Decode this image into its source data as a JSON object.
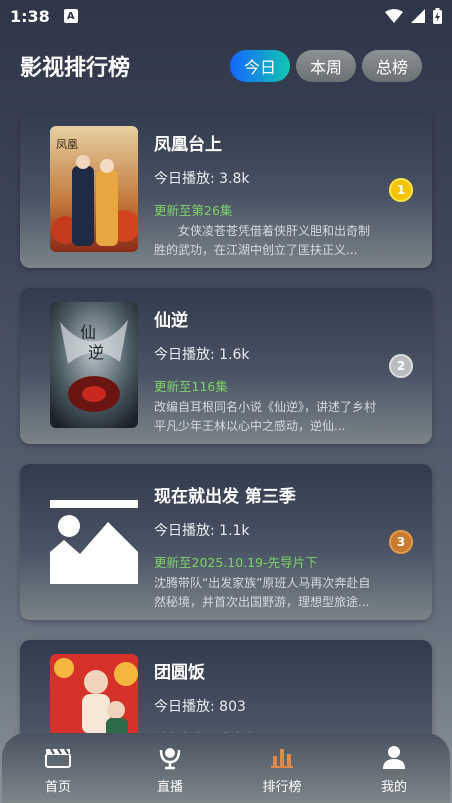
{
  "status_bar": {
    "time": "1:38",
    "notification_icon": "a-badge-icon"
  },
  "header": {
    "title": "影视排行榜"
  },
  "tabs": [
    {
      "label": "今日",
      "active": true
    },
    {
      "label": "本周",
      "active": false
    },
    {
      "label": "总榜",
      "active": false
    }
  ],
  "items": [
    {
      "title": "凤凰台上",
      "plays": "今日播放: 3.8k",
      "update": "更新至第26集",
      "desc": "　　女侠凌苍苍凭借着侠肝义胆和出奇制胜的武功，在江湖中创立了匡扶正义...",
      "rank": "1",
      "rank_color": "#f5c400"
    },
    {
      "title": "仙逆",
      "plays": "今日播放: 1.6k",
      "update": "更新至116集",
      "desc": "改编自耳根同名小说《仙逆》，讲述了乡村平凡少年王林以心中之感动，逆仙...",
      "rank": "2",
      "rank_color": "#b9bcbf"
    },
    {
      "title": "现在就出发 第三季",
      "plays": "今日播放: 1.1k",
      "update": "更新至2025.10.19-先导片下",
      "desc": "沈腾带队“出发家族”原班人马再次奔赴自然秘境，并首次出国野游，理想型旅途...",
      "rank": "3",
      "rank_color": "#c97a2e"
    },
    {
      "title": "团圆饭",
      "plays": "今日播放: 803",
      "update": "单亲家庭母爱破防",
      "desc": "",
      "rank": "",
      "rank_color": ""
    }
  ],
  "nav": [
    {
      "label": "首页",
      "icon": "clapperboard-icon",
      "active": false
    },
    {
      "label": "直播",
      "icon": "live-icon",
      "active": false
    },
    {
      "label": "排行榜",
      "icon": "bar-chart-icon",
      "active": true
    },
    {
      "label": "我的",
      "icon": "person-icon",
      "active": false
    }
  ],
  "colors": {
    "accent_start": "#1366ff",
    "accent_end": "#12c6b0",
    "update_green": "#7cd36a",
    "nav_active": "#e0884a"
  }
}
